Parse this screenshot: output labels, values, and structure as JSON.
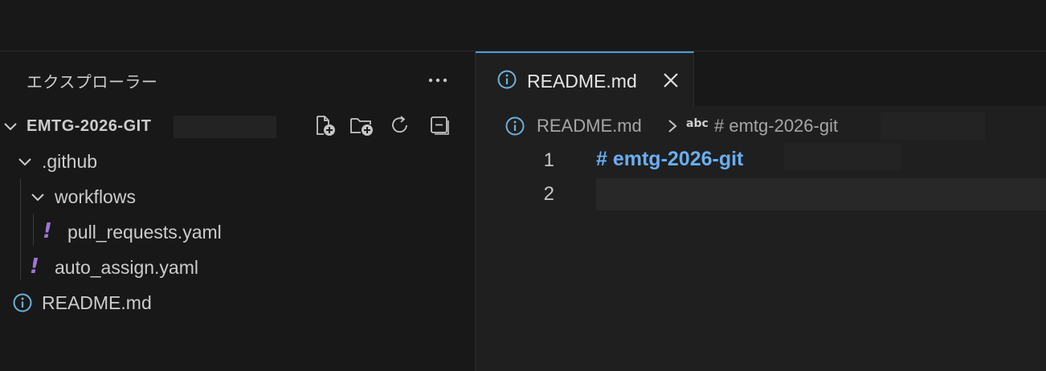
{
  "sidebar": {
    "title": "エクスプローラー",
    "more_icon": "ellipsis-icon",
    "workspace": {
      "name": "EMTG-2026-GIT",
      "actions": [
        {
          "name": "new-file-button",
          "icon": "new-file-icon"
        },
        {
          "name": "new-folder-button",
          "icon": "new-folder-icon"
        },
        {
          "name": "refresh-button",
          "icon": "refresh-icon"
        },
        {
          "name": "collapse-all-button",
          "icon": "collapse-all-icon"
        }
      ]
    },
    "tree": [
      {
        "label": ".github",
        "type": "folder"
      },
      {
        "label": "workflows",
        "type": "folder"
      },
      {
        "label": "pull_requests.yaml",
        "type": "yaml"
      },
      {
        "label": "auto_assign.yaml",
        "type": "yaml"
      },
      {
        "label": "README.md",
        "type": "markdown"
      }
    ],
    "yaml_icon_glyph": "!"
  },
  "editor": {
    "tab": {
      "label": "README.md",
      "icon": "info-icon",
      "close_icon": "close-icon"
    },
    "breadcrumb": {
      "file": "README.md",
      "symbol_glyph": "abc",
      "heading": "# emtg-2026-git"
    },
    "lines": [
      {
        "number": "1",
        "text": "# emtg-2026-git"
      },
      {
        "number": "2",
        "text": ""
      }
    ]
  },
  "colors": {
    "accent": "#4a9ed8",
    "yaml": "#a175d6",
    "heading": "#6aaef0",
    "info_icon": "#6fb0d9"
  }
}
